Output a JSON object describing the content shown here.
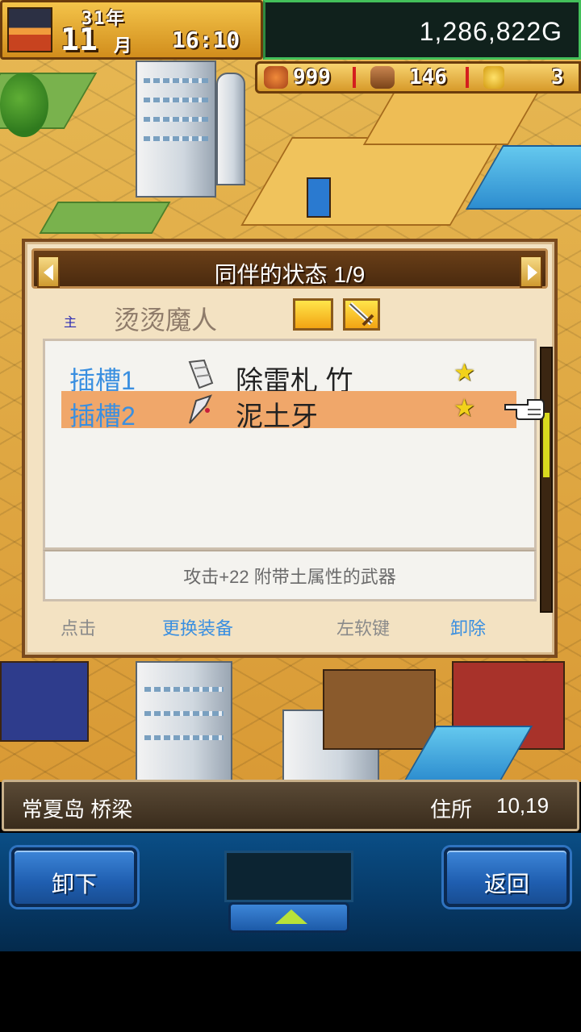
{
  "hud": {
    "year": "31年",
    "month": "11",
    "month_unit": "月",
    "time": "16:10",
    "money": "1,286,822",
    "currency": "G",
    "resources": {
      "food": "999",
      "wood": "146",
      "medal": "3"
    }
  },
  "dialog": {
    "title": "同伴的状态 1/9",
    "char_mark": "主",
    "char_name": "烫烫魔人",
    "slots": [
      {
        "label": "插槽1",
        "item": "除雷札 竹",
        "icon": "bamboo-charm-icon",
        "selected": false
      },
      {
        "label": "插槽2",
        "item": "泥土牙",
        "icon": "earth-fang-icon",
        "selected": true
      }
    ],
    "description": "攻击+22 附带土属性的武器",
    "hints": {
      "tap": "点击",
      "tap_action": "更换装备",
      "left_softkey": "左软键",
      "left_softkey_action": "卸除"
    }
  },
  "status": {
    "location": "常夏岛 桥梁",
    "address_label": "住所",
    "address_value": "10,19"
  },
  "controls": {
    "left_button": "卸下",
    "right_button": "返回"
  },
  "colors": {
    "slot_label": "#3a8fe0",
    "hint_action": "#3a8fe0",
    "selected_row": "#f0a76a",
    "dialog_bg": "#f3e2c2"
  }
}
